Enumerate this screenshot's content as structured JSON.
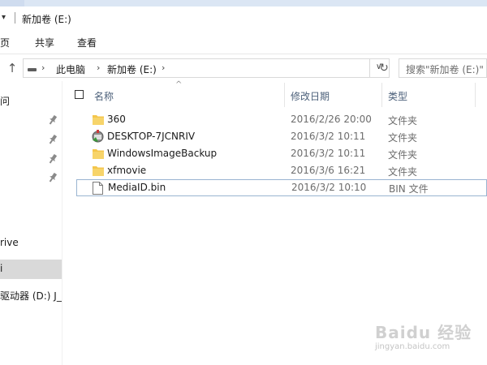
{
  "window": {
    "title": "新加卷 (E:)",
    "quick_access_arrow": "▾"
  },
  "ribbon": {
    "tabs": [
      "页",
      "共享",
      "查看"
    ]
  },
  "address_bar": {
    "up_glyph": "↑",
    "chevron": "›",
    "crumbs": [
      "此电脑",
      "新加卷 (E:)"
    ],
    "dropdown_glyph": "∨",
    "refresh_glyph": "↻"
  },
  "search": {
    "placeholder": "搜索\"新加卷 (E:)\""
  },
  "nav_pane": {
    "items": [
      {
        "label": "问"
      },
      {
        "label": "rive"
      },
      {
        "label": "i"
      },
      {
        "label": "驱动器 (D:) J_C"
      }
    ],
    "selected_index": 2,
    "pinned_count": 4
  },
  "columns": {
    "name": "名称",
    "date": "修改日期",
    "type": "类型",
    "sort_glyph": "^"
  },
  "files": [
    {
      "name": "360",
      "date": "2016/2/26 20:00",
      "type": "文件夹",
      "icon": "folder-icon"
    },
    {
      "name": "DESKTOP-7JCNRIV",
      "date": "2016/3/2 10:11",
      "type": "文件夹",
      "icon": "network-folder-icon"
    },
    {
      "name": "WindowsImageBackup",
      "date": "2016/3/2 10:11",
      "type": "文件夹",
      "icon": "folder-icon"
    },
    {
      "name": "xfmovie",
      "date": "2016/3/6 16:21",
      "type": "文件夹",
      "icon": "folder-icon"
    },
    {
      "name": "MediaID.bin",
      "date": "2016/3/2 10:10",
      "type": "BIN 文件",
      "icon": "file-icon",
      "selected": true
    }
  ],
  "watermark": {
    "brand": "Baidu 经验",
    "url": "jingyan.baidu.com"
  },
  "colors": {
    "folder": "#f4c64c",
    "selection_border": "#99b4d1",
    "nav_selection": "#d9d9d9",
    "column_header_text": "#4c607a"
  }
}
